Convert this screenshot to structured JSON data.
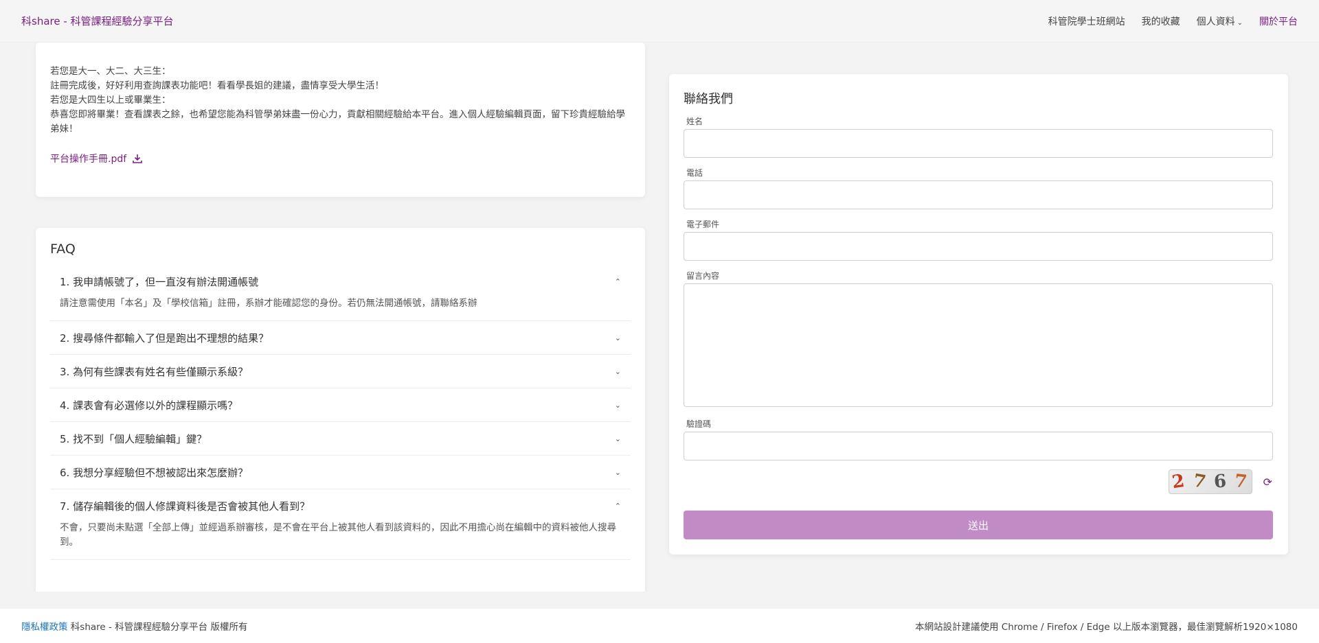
{
  "navbar": {
    "brand": "科share - 科管課程經驗分享平台",
    "links": [
      "科管院學士班網站",
      "我的收藏",
      "個人資料",
      "關於平台"
    ]
  },
  "usage": {
    "lines": [
      "若您是大一、大二、大三生：",
      "註冊完成後，好好利用查詢課表功能吧！看看學長姐的建議，盡情享受大學生活！",
      "若您是大四生以上或畢業生：",
      "恭喜您即將畢業！查看課表之餘，也希望您能為科管學弟妹盡一份心力，貢獻相關經驗給本平台。進入個人經驗編輯頁面，留下珍貴經驗給學弟妹！"
    ],
    "pdf_link": "平台操作手冊.pdf"
  },
  "faq": {
    "title": "FAQ",
    "items": [
      {
        "q": "1. 我申請帳號了，但一直沒有辦法開通帳號",
        "a": "請注意需使用「本名」及「學校信箱」註冊，系辦才能確認您的身份。若仍無法開通帳號，請聯絡系辦",
        "open": true
      },
      {
        "q": "2. 搜尋條件都輸入了但是跑出不理想的結果？",
        "a": "",
        "open": false
      },
      {
        "q": "3. 為何有些課表有姓名有些僅顯示系級？",
        "a": "",
        "open": false
      },
      {
        "q": "4. 課表會有必選修以外的課程顯示嗎？",
        "a": "",
        "open": false
      },
      {
        "q": "5. 找不到「個人經驗編輯」鍵？",
        "a": "",
        "open": false
      },
      {
        "q": "6. 我想分享經驗但不想被認出來怎麼辦？",
        "a": "",
        "open": false
      },
      {
        "q": "7. 儲存編輯後的個人修課資料後是否會被其他人看到？",
        "a": "不會，只要尚未點選「全部上傳」並經過系辦審核，是不會在平台上被其他人看到該資料的，因此不用擔心尚在編輯中的資料被他人搜尋到。",
        "open": true
      }
    ]
  },
  "contact": {
    "title": "聯絡我們",
    "labels": {
      "name": "姓名",
      "phone": "電話",
      "email": "電子郵件",
      "message": "留言內容",
      "captcha": "驗證碼"
    },
    "captcha_chars": [
      "2",
      "7",
      "6",
      "7"
    ],
    "captcha_colors": [
      "#c23b22",
      "#8a5a2a",
      "#555555",
      "#c4622d"
    ],
    "submit": "送出"
  },
  "footer": {
    "privacy": "隱私權政策",
    "copyright": "科share - 科管課程經驗分享平台 版權所有",
    "browser_note": "本網站設計建議使用 Chrome / Firefox / Edge 以上版本瀏覽器，最佳瀏覽解析1920×1080"
  },
  "colors": {
    "brand": "#7a1f82",
    "submit": "#c18bc6",
    "privacy_link": "#1e73be"
  }
}
